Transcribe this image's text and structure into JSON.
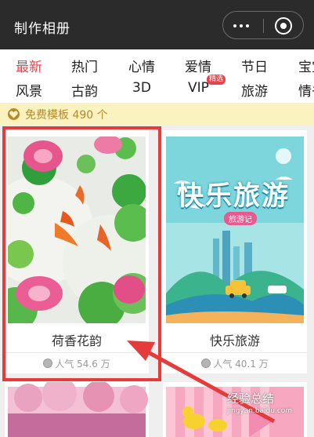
{
  "header": {
    "title": "制作相册"
  },
  "categories": [
    {
      "label": "最新",
      "active": true
    },
    {
      "label": "热门"
    },
    {
      "label": "心情"
    },
    {
      "label": "爱情"
    },
    {
      "label": "节日"
    },
    {
      "label": "宝宝"
    },
    {
      "label": "风景"
    },
    {
      "label": "古韵"
    },
    {
      "label": "3D"
    },
    {
      "label": "VIP"
    },
    {
      "label": "旅游"
    },
    {
      "label": "情书"
    }
  ],
  "vip_badge": "精选",
  "notice": {
    "text": "免费模板 490 个"
  },
  "templates": [
    {
      "name": "荷香花韵",
      "popularity": "人气 54.6 万"
    },
    {
      "name": "快乐旅游",
      "popularity": "人气 40.1 万"
    }
  ],
  "travel_art": {
    "title": "快乐旅游",
    "ribbon": "旅游记"
  },
  "watermark": {
    "main": "经验总结",
    "sub": "jingyan.baidu.com"
  },
  "colors": {
    "accent": "#e8424d",
    "highlight": "#e63b3b",
    "notice_bg": "#fbf3bf"
  }
}
